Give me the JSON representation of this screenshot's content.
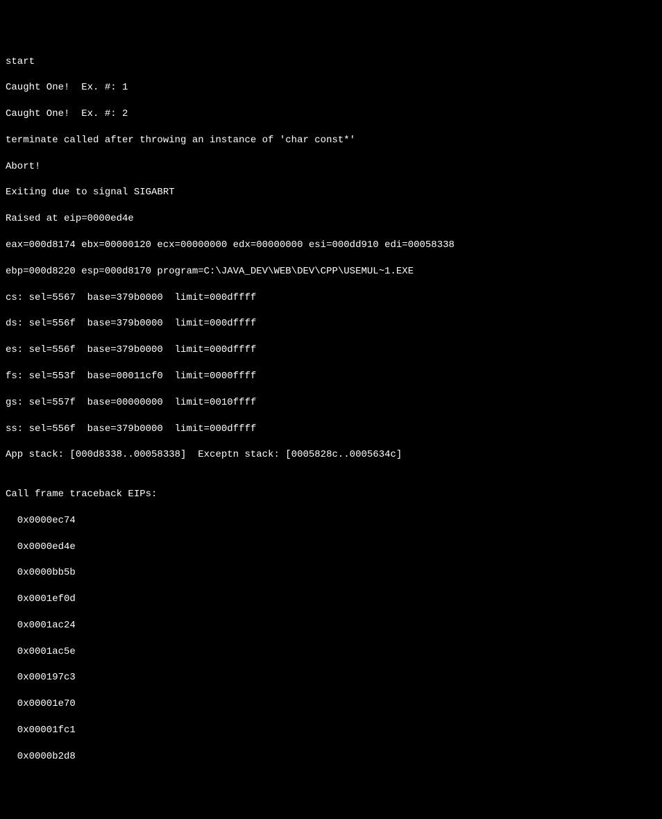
{
  "lines": {
    "l0": "start",
    "l1": "Caught One!  Ex. #: 1",
    "l2": "Caught One!  Ex. #: 2",
    "l3": "terminate called after throwing an instance of 'char const*'",
    "l4": "Abort!",
    "l5": "Exiting due to signal SIGABRT",
    "l6": "Raised at eip=0000ed4e",
    "l7": "eax=000d8174 ebx=00000120 ecx=00000000 edx=00000000 esi=000dd910 edi=00058338",
    "l8": "ebp=000d8220 esp=000d8170 program=C:\\JAVA_DEV\\WEB\\DEV\\CPP\\USEMUL~1.EXE",
    "l9": "cs: sel=5567  base=379b0000  limit=000dffff",
    "l10": "ds: sel=556f  base=379b0000  limit=000dffff",
    "l11": "es: sel=556f  base=379b0000  limit=000dffff",
    "l12": "fs: sel=553f  base=00011cf0  limit=0000ffff",
    "l13": "gs: sel=557f  base=00000000  limit=0010ffff",
    "l14": "ss: sel=556f  base=379b0000  limit=000dffff",
    "l15": "App stack: [000d8338..00058338]  Exceptn stack: [0005828c..0005634c]",
    "l16": "",
    "l17": "Call frame traceback EIPs:",
    "l18": "0x0000ec74",
    "l19": "0x0000ed4e",
    "l20": "0x0000bb5b",
    "l21": "0x0001ef0d",
    "l22": "0x0001ac24",
    "l23": "0x0001ac5e",
    "l24": "0x000197c3",
    "l25": "0x00001e70",
    "l26": "0x00001fc1",
    "l27": "0x0000b2d8"
  }
}
